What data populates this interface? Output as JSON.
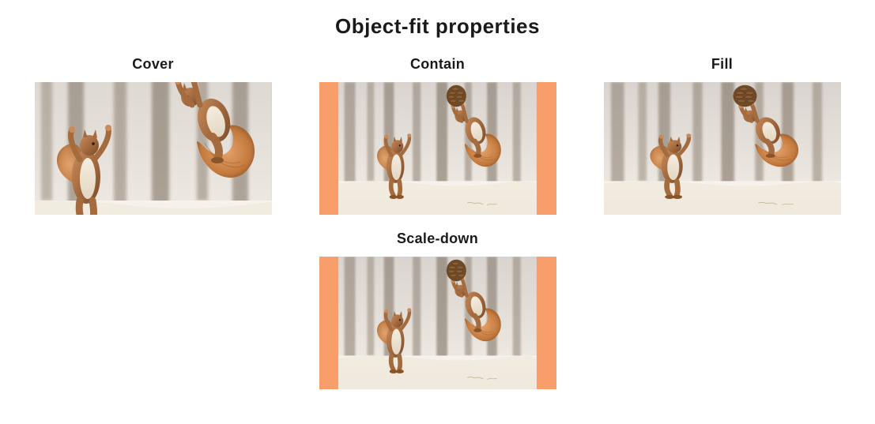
{
  "title": "Object-fit properties",
  "examples": {
    "cover": {
      "label": "Cover",
      "fit": "cover"
    },
    "contain": {
      "label": "Contain",
      "fit": "contain"
    },
    "fill": {
      "label": "Fill",
      "fit": "fill"
    },
    "scaledown": {
      "label": "Scale-down",
      "fit": "scale-down"
    }
  },
  "image": {
    "alt": "Two squirrels playing in the snow with a pine cone",
    "natural_width": 400,
    "natural_height": 268
  },
  "colors": {
    "frame_bg": "#f79e6b",
    "text": "#1a1a1a"
  }
}
